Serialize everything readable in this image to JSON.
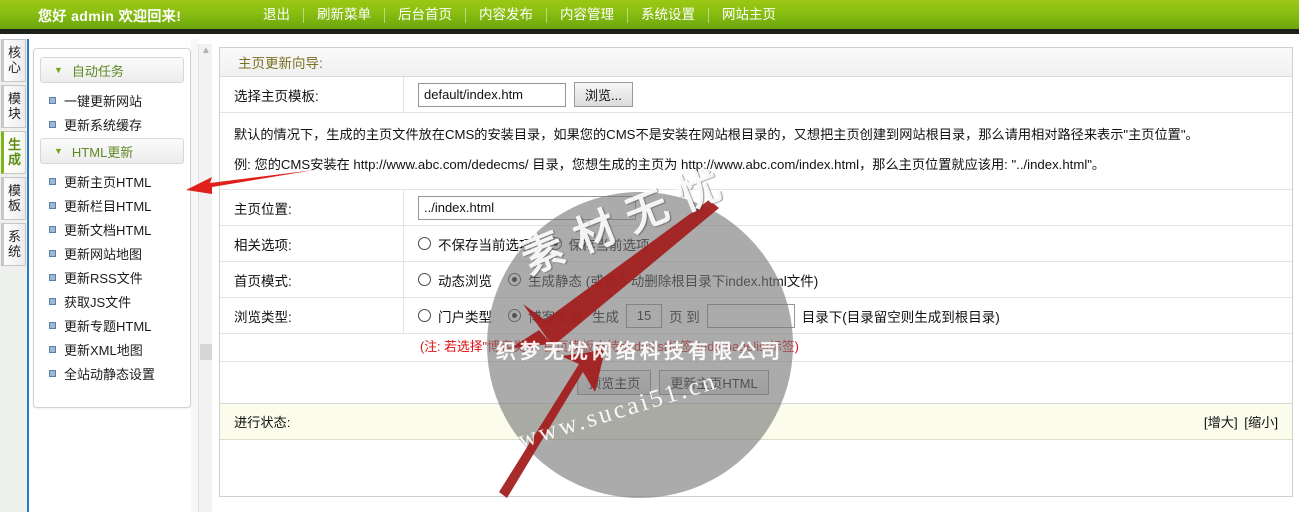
{
  "topbar": {
    "welcome": "您好 admin 欢迎回来!",
    "nav": [
      "退出",
      "刷新菜单",
      "后台首页",
      "内容发布",
      "内容管理",
      "系统设置",
      "网站主页"
    ]
  },
  "vtabs": [
    {
      "label": "核心",
      "active": false
    },
    {
      "label": "模块",
      "active": false
    },
    {
      "label": "生成",
      "active": true
    },
    {
      "label": "模板",
      "active": false
    },
    {
      "label": "系统",
      "active": false
    }
  ],
  "sidebar": {
    "groups": [
      {
        "title": "自动任务",
        "chevron": "chevron-down-icon",
        "items": [
          "一键更新网站",
          "更新系统缓存"
        ]
      },
      {
        "title": "HTML更新",
        "chevron": "chevron-down-icon",
        "items": [
          "更新主页HTML",
          "更新栏目HTML",
          "更新文档HTML",
          "更新网站地图",
          "更新RSS文件",
          "获取JS文件",
          "更新专题HTML",
          "更新XML地图",
          "全站动静态设置"
        ]
      }
    ],
    "scroll_up_icon": "chevron-up-icon"
  },
  "main": {
    "panel_title": "主页更新向导:",
    "rows": {
      "template": {
        "label": "选择主页模板:",
        "value": "default/index.htm",
        "browse_button": "浏览..."
      },
      "desc_line1": "默认的情况下，生成的主页文件放在CMS的安装目录，如果您的CMS不是安装在网站根目录的，又想把主页创建到网站根目录，那么请用相对路径来表示\"主页位置\"。",
      "desc_line2": "例: 您的CMS安装在 http://www.abc.com/dedecms/ 目录，您想生成的主页为 http://www.abc.com/index.html，那么主页位置就应该用: \"../index.html\"。",
      "position": {
        "label": "主页位置:",
        "value": "../index.html"
      },
      "options": {
        "label": "相关选项:",
        "choices": [
          {
            "text": "不保存当前选项",
            "selected": false
          },
          {
            "text": "保存当前选项",
            "selected": true
          }
        ]
      },
      "homemode": {
        "label": "首页模式:",
        "choices": [
          {
            "text": "动态浏览",
            "selected": false
          },
          {
            "text": "生成静态 (或者手动删除根目录下index.html文件)",
            "selected": true
          }
        ]
      },
      "browsetype": {
        "label": "浏览类型:",
        "choices": [
          {
            "text": "门户类型",
            "selected": false
          },
          {
            "text": "博客类型",
            "selected": true
          }
        ],
        "gen_prefix": "生成",
        "pages_value": "15",
        "gen_mid": "页 到",
        "dir_value": "",
        "gen_suffix": "目录下(目录留空则生成到根目录)"
      },
      "red_note": "(注: 若选择\"博客类型\"首页模板支持dede:list标签dede:pagelist标签)"
    },
    "buttons": {
      "preview": "预览主页",
      "update": "更新主页HTML"
    },
    "status": {
      "label": "进行状态:",
      "zoom_in": "[增大]",
      "zoom_out": "[缩小]"
    }
  },
  "watermark": {
    "diagonal": "素材无忧",
    "company": "织梦无忧网络科技有限公司",
    "site": "www.sucai51.cn",
    "arrow_color": "#b32020"
  },
  "colors": {
    "header_green": "#8cc012",
    "accent_green": "#7cb619",
    "note_red": "#dd1111",
    "tab_border_blue": "#2f78c4"
  }
}
